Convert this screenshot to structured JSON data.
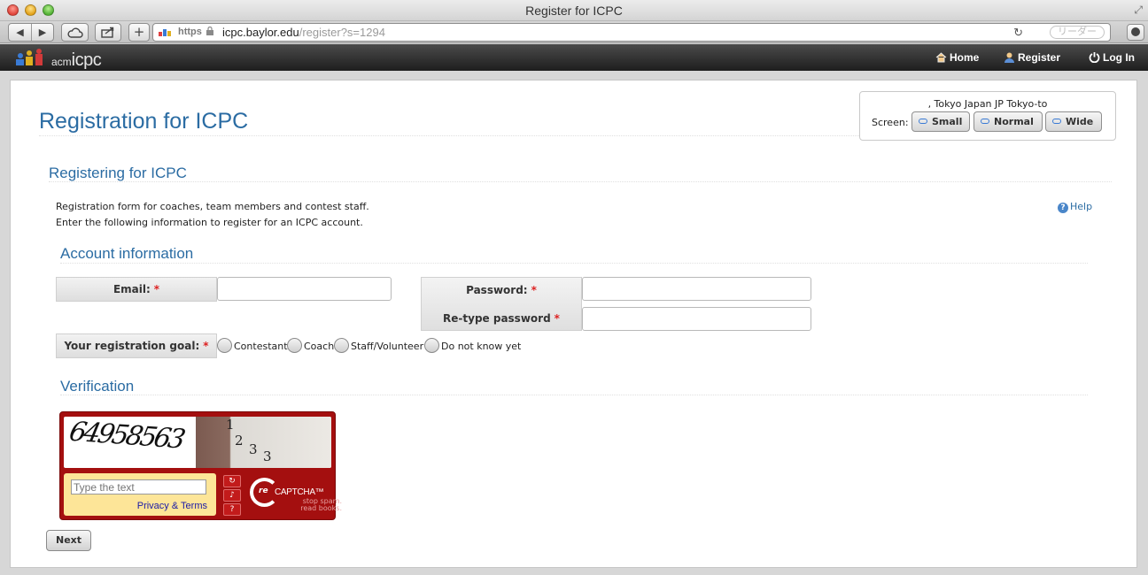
{
  "browser": {
    "window_title": "Register for ICPC",
    "address": {
      "scheme_label": "https",
      "host": "icpc.baylor.edu",
      "path": "/register?s=1294"
    },
    "reader_label": "リーダー"
  },
  "nav": {
    "logo": {
      "acm": "acm",
      "icpc": "icpc"
    },
    "home_label": "Home",
    "register_label": "Register",
    "login_label": "Log In"
  },
  "header": {
    "page_title": "Registration for ICPC",
    "location_text": ", Tokyo Japan JP Tokyo-to",
    "screen_label": "Screen:",
    "screen_buttons": [
      "Small",
      "Normal",
      "Wide"
    ]
  },
  "main": {
    "section_title": "Registering for ICPC",
    "intro_lines": [
      "Registration form for coaches, team members and contest staff.",
      "Enter the following information to register for an ICPC account."
    ],
    "help_label": "Help"
  },
  "account": {
    "title": "Account information",
    "email_label": "Email:",
    "password_label": "Password:",
    "retype_label": "Re-type password",
    "required_mark": "*",
    "email_value": "",
    "password_value": "",
    "retype_value": "",
    "goal_label": "Your registration goal:",
    "goal_options": [
      "Contestant",
      "Coach",
      "Staff/Volunteer",
      "Do not know yet"
    ]
  },
  "verification": {
    "title": "Verification",
    "captcha_word": "64958563",
    "captcha_photo_digits": [
      "1",
      "2",
      "3",
      "3"
    ],
    "input_placeholder": "Type the text",
    "privacy_label": "Privacy & Terms",
    "brand": "reCAPTCHA",
    "brand_prefix": "re",
    "brand_main": "CAPTCHA™",
    "tagline": "stop spam. read books."
  },
  "actions": {
    "next_label": "Next"
  }
}
